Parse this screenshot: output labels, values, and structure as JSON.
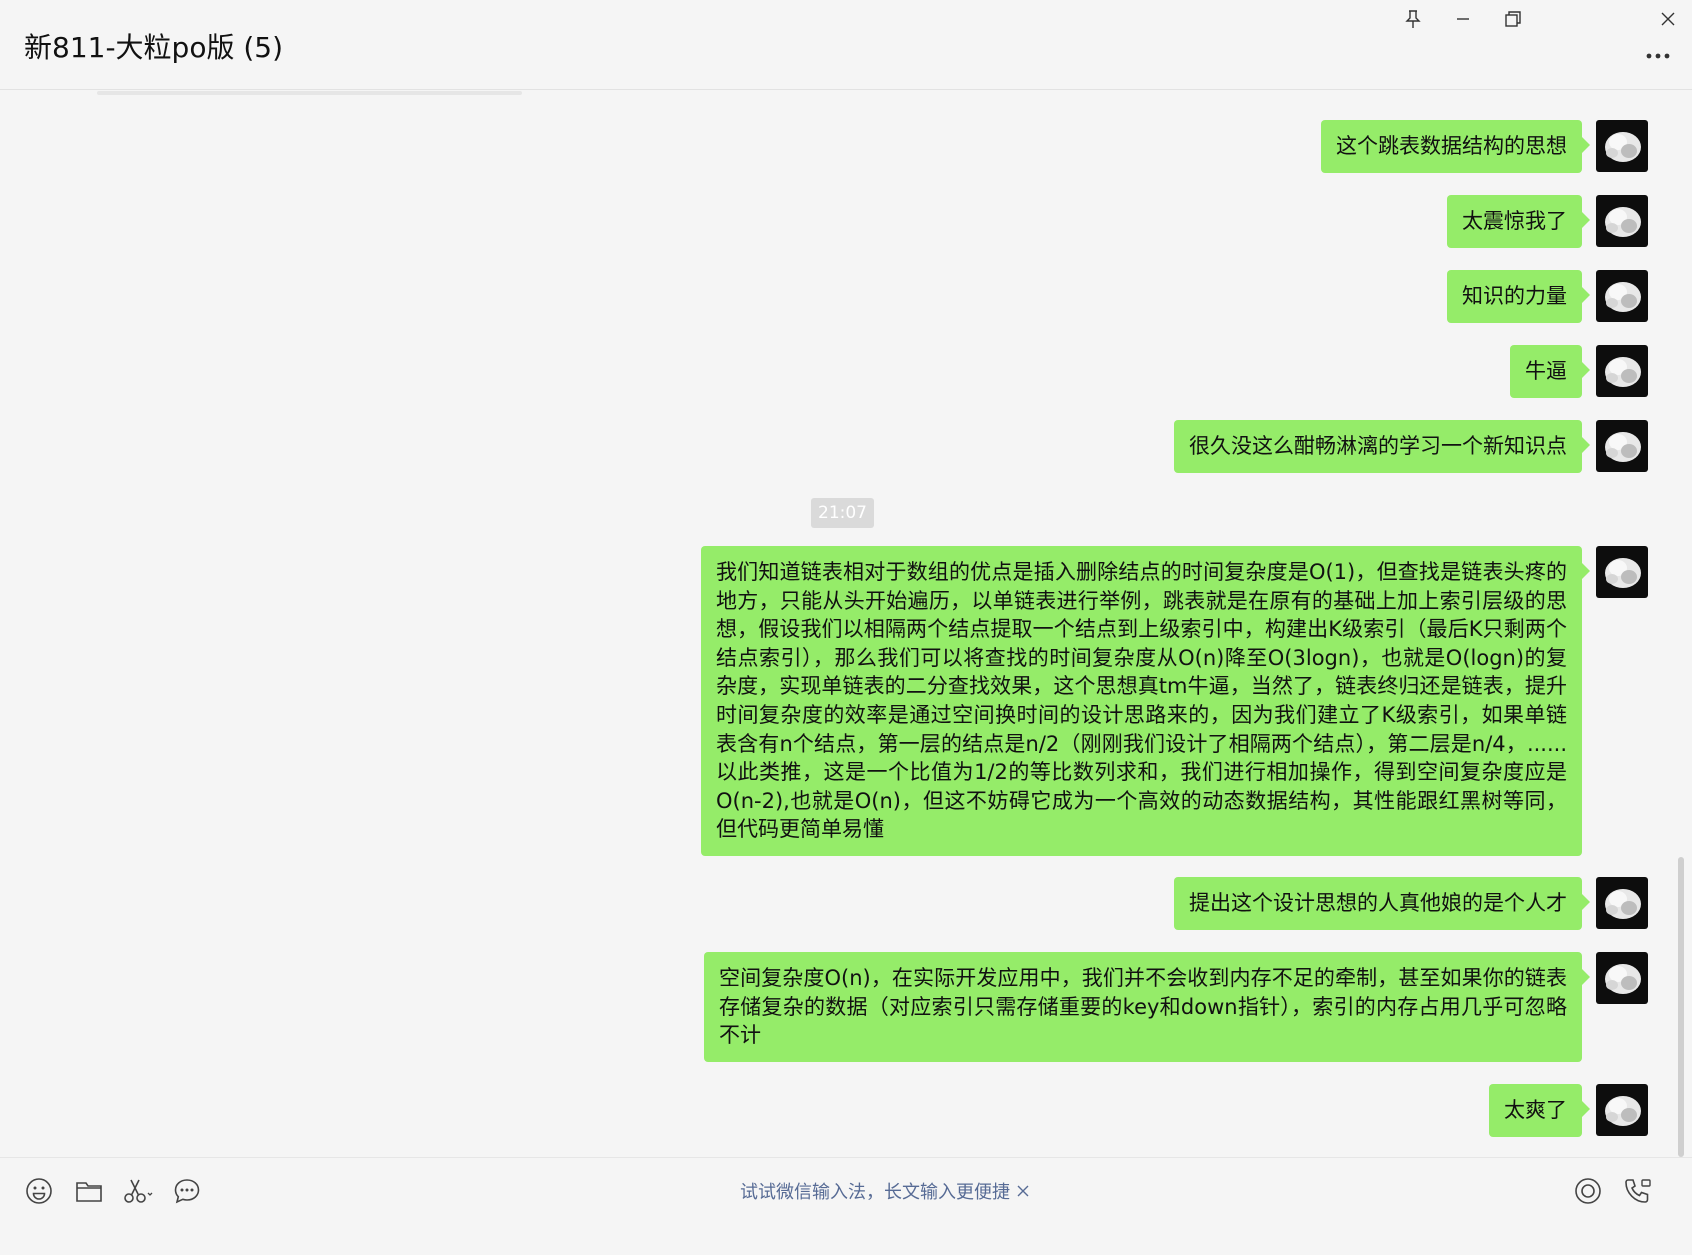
{
  "window": {
    "title": "新811-大粒po版 (5)",
    "controls": [
      "pin-icon",
      "minimize-icon",
      "restore-icon",
      "close-icon"
    ],
    "more_icon": "more-dots-icon"
  },
  "messages": [
    {
      "sender": "me",
      "text": "这个跳表数据结构的思想"
    },
    {
      "sender": "me",
      "text": "太震惊我了"
    },
    {
      "sender": "me",
      "text": "知识的力量"
    },
    {
      "sender": "me",
      "text": "牛逼"
    },
    {
      "sender": "me",
      "text": "很久没这么酣畅淋漓的学习一个新知识点"
    },
    {
      "timestamp": "21:07"
    },
    {
      "sender": "me",
      "text": "我们知道链表相对于数组的优点是插入删除结点的时间复杂度是O(1)，但查找是链表头疼的地方，只能从头开始遍历，以单链表进行举例，跳表就是在原有的基础上加上索引层级的思想，假设我们以相隔两个结点提取一个结点到上级索引中，构建出K级索引（最后K只剩两个结点索引），那么我们可以将查找的时间复杂度从O(n)降至O(3logn)，也就是O(logn)的复杂度，实现单链表的二分查找效果，这个思想真tm牛逼，当然了，链表终归还是链表，提升时间复杂度的效率是通过空间换时间的设计思路来的，因为我们建立了K级索引，如果单链表含有n个结点，第一层的结点是n/2（刚刚我们设计了相隔两个结点），第二层是n/4，......以此类推，这是一个比值为1/2的等比数列求和，我们进行相加操作，得到空间复杂度应是O(n-2),也就是O(n)，但这不妨碍它成为一个高效的动态数据结构，其性能跟红黑树等同，但代码更简单易懂"
    },
    {
      "sender": "me",
      "text": "提出这个设计思想的人真他娘的是个人才"
    },
    {
      "sender": "me",
      "text": "空间复杂度O(n)，在实际开发应用中，我们并不会收到内存不足的牵制，甚至如果你的链表存储复杂的数据（对应索引只需存储重要的key和down指针），索引的内存占用几乎可忽略不计"
    },
    {
      "sender": "me",
      "text": "太爽了"
    }
  ],
  "toolbar": {
    "left_icons": [
      "emoji-icon",
      "folder-icon",
      "scissors-icon",
      "chat-history-icon"
    ],
    "ime_tip": "试试微信输入法，长文输入更便捷",
    "right_icons": [
      "live-icon",
      "call-icon"
    ]
  },
  "colors": {
    "bubble_me": "#95ec69",
    "background": "#f5f5f5",
    "link": "#576b95"
  }
}
